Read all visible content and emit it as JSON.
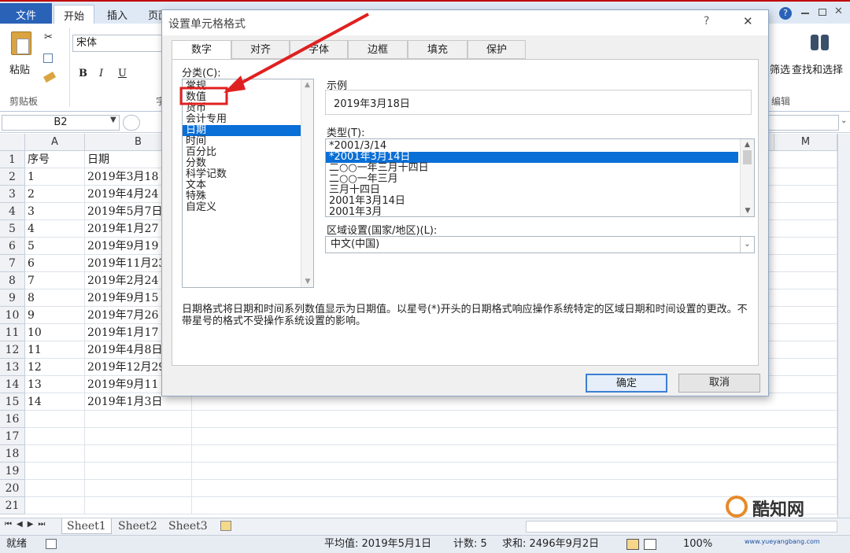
{
  "ribbon": {
    "file_tab": "文件",
    "tabs": [
      "开始",
      "插入",
      "页面"
    ],
    "clipboard_paste": "粘贴",
    "clipboard_group": "剪贴板",
    "font_name": "宋体",
    "font_group_partial": "字",
    "filter_label": "筛选",
    "find_select": "查找和选择",
    "edit_group": "编辑"
  },
  "formula_bar": {
    "name_box": "B2"
  },
  "sheet": {
    "columns": [
      "A",
      "B",
      "M"
    ],
    "rows": [
      {
        "n": "1",
        "a": "序号",
        "b": "日期"
      },
      {
        "n": "2",
        "a": "1",
        "b": "2019年3月18"
      },
      {
        "n": "3",
        "a": "2",
        "b": "2019年4月24"
      },
      {
        "n": "4",
        "a": "3",
        "b": "2019年5月7日"
      },
      {
        "n": "5",
        "a": "4",
        "b": "2019年1月27"
      },
      {
        "n": "6",
        "a": "5",
        "b": "2019年9月19"
      },
      {
        "n": "7",
        "a": "6",
        "b": "2019年11月23"
      },
      {
        "n": "8",
        "a": "7",
        "b": "2019年2月24"
      },
      {
        "n": "9",
        "a": "8",
        "b": "2019年9月15"
      },
      {
        "n": "10",
        "a": "9",
        "b": "2019年7月26"
      },
      {
        "n": "11",
        "a": "10",
        "b": "2019年1月17"
      },
      {
        "n": "12",
        "a": "11",
        "b": "2019年4月8日"
      },
      {
        "n": "13",
        "a": "12",
        "b": "2019年12月29"
      },
      {
        "n": "14",
        "a": "13",
        "b": "2019年9月11"
      },
      {
        "n": "15",
        "a": "14",
        "b": "2019年1月3日"
      },
      {
        "n": "16",
        "a": "",
        "b": ""
      },
      {
        "n": "17",
        "a": "",
        "b": ""
      },
      {
        "n": "18",
        "a": "",
        "b": ""
      },
      {
        "n": "19",
        "a": "",
        "b": ""
      },
      {
        "n": "20",
        "a": "",
        "b": ""
      },
      {
        "n": "21",
        "a": "",
        "b": ""
      }
    ],
    "tabs": [
      "Sheet1",
      "Sheet2",
      "Sheet3"
    ]
  },
  "status": {
    "ready": "就绪",
    "average": "平均值: 2019年5月1日",
    "count": "计数: 5",
    "sum": "求和: 2496年9月2日",
    "zoom": "100%"
  },
  "dialog": {
    "title": "设置单元格格式",
    "help": "?",
    "close": "✕",
    "tabs": [
      "数字",
      "对齐",
      "字体",
      "边框",
      "填充",
      "保护"
    ],
    "category_label": "分类(C):",
    "categories": [
      "常规",
      "数值",
      "货币",
      "会计专用",
      "日期",
      "时间",
      "百分比",
      "分数",
      "科学记数",
      "文本",
      "特殊",
      "自定义"
    ],
    "selected_category": "日期",
    "sample_label": "示例",
    "sample_value": "2019年3月18日",
    "type_label": "类型(T):",
    "types": [
      "*2001/3/14",
      "*2001年3月14日",
      "二○○一年三月十四日",
      "二○○一年三月",
      "三月十四日",
      "2001年3月14日",
      "2001年3月"
    ],
    "locale_label": "区域设置(国家/地区)(L):",
    "locale_value": "中文(中国)",
    "description": "日期格式将日期和时间系列数值显示为日期值。以星号(*)开头的日期格式响应操作系统特定的区域日期和时间设置的更改。不带星号的格式不受操作系统设置的影响。",
    "ok": "确定",
    "cancel": "取消"
  },
  "watermark": {
    "brand": "酷知网",
    "site": "www.yueyangbang.com"
  },
  "colors": {
    "accent": "#2a62b8",
    "highlight": "#e02020",
    "selection": "#0a6fd6"
  }
}
